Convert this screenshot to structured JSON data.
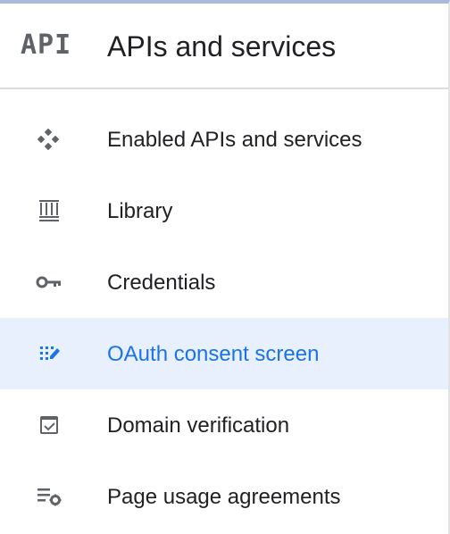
{
  "header": {
    "logo_text": "API",
    "title": "APIs and services"
  },
  "nav": {
    "items": [
      {
        "label": "Enabled APIs and services",
        "icon": "enabled-apis-icon",
        "active": false
      },
      {
        "label": "Library",
        "icon": "library-icon",
        "active": false
      },
      {
        "label": "Credentials",
        "icon": "key-icon",
        "active": false
      },
      {
        "label": "OAuth consent screen",
        "icon": "oauth-consent-icon",
        "active": true
      },
      {
        "label": "Domain verification",
        "icon": "domain-verification-icon",
        "active": false
      },
      {
        "label": "Page usage agreements",
        "icon": "page-usage-settings-icon",
        "active": false
      }
    ]
  },
  "colors": {
    "active_background": "#e8f0fe",
    "active_text": "#1a73e8",
    "icon_gray": "#5f6368",
    "text": "#202124"
  }
}
